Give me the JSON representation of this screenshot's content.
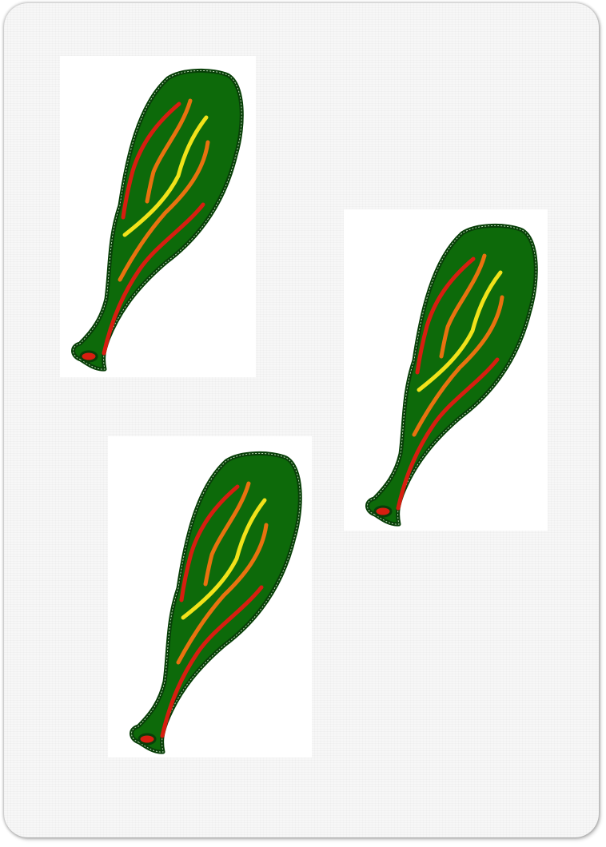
{
  "card": {
    "suit": "clubs",
    "rank": 3,
    "pip_icon": "club-cudgel-icon"
  },
  "colors": {
    "card_face": "#f7f7f7",
    "panel": "#ffffff",
    "club_body": "#0d6a0a",
    "club_outline": "#083f08",
    "highlight_outline": "#c9e3c2",
    "stripe_red": "#d71e10",
    "stripe_orange": "#e8720f",
    "stripe_yellow": "#f1e21a"
  }
}
